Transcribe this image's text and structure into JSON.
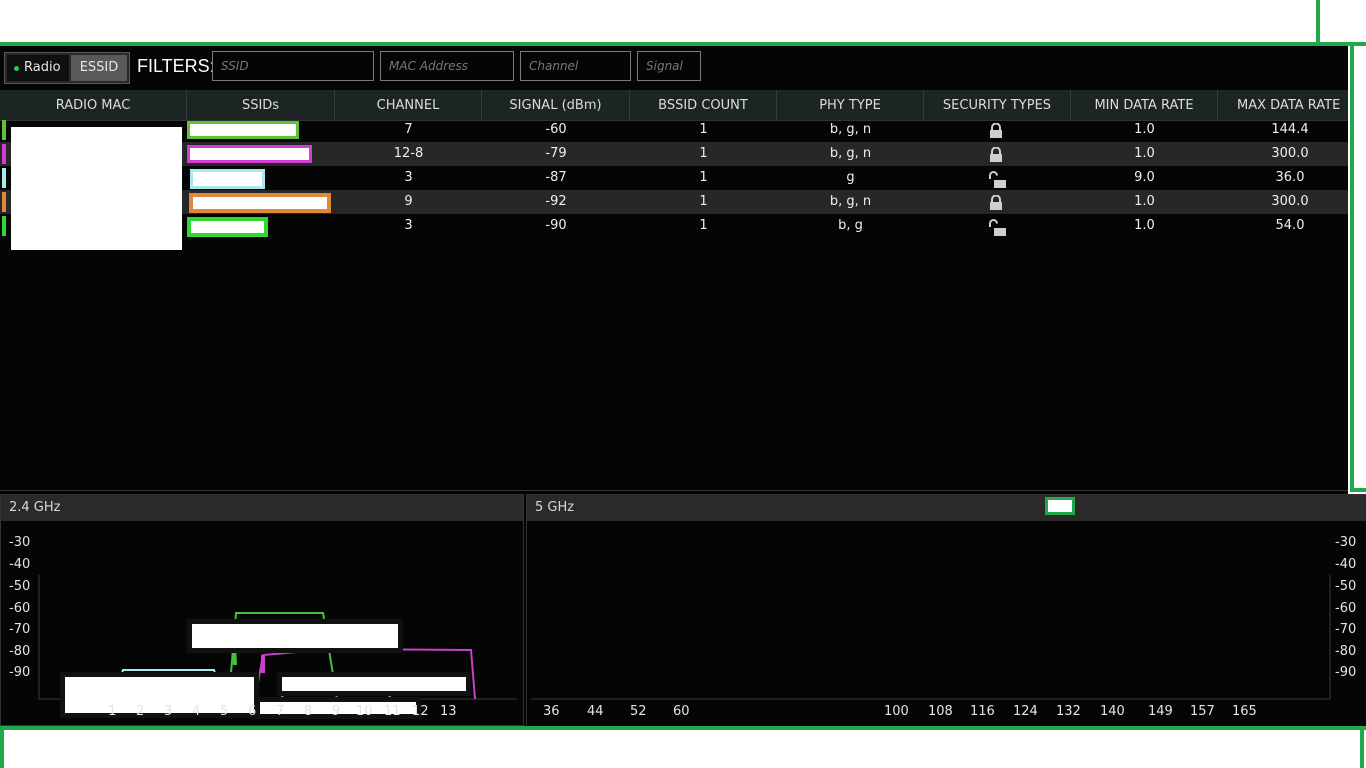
{
  "toolbar": {
    "mode_radio": "Radio",
    "mode_essid": "ESSID",
    "active_mode": "Radio",
    "filters_label": "FILTERS:",
    "ssid_placeholder": "SSID",
    "mac_placeholder": "MAC Address",
    "channel_placeholder": "Channel",
    "signal_placeholder": "Signal"
  },
  "table": {
    "headers": [
      "RADIO MAC",
      "SSIDs",
      "CHANNEL",
      "SIGNAL (dBm)",
      "BSSID COUNT",
      "PHY TYPE",
      "SECURITY TYPES",
      "MIN DATA RATE",
      "MAX DATA RATE"
    ],
    "rows": [
      {
        "color": "#5ec232",
        "channel": "7",
        "signal": "-60",
        "bssid_count": "1",
        "phy": "b, g, n",
        "secured": true,
        "min_rate": "1.0",
        "max_rate": "144.4"
      },
      {
        "color": "#d63bd6",
        "channel": "12-8",
        "signal": "-79",
        "bssid_count": "1",
        "phy": "b, g, n",
        "secured": true,
        "min_rate": "1.0",
        "max_rate": "300.0"
      },
      {
        "color": "#a8e8f0",
        "channel": "3",
        "signal": "-87",
        "bssid_count": "1",
        "phy": "g",
        "secured": false,
        "min_rate": "9.0",
        "max_rate": "36.0"
      },
      {
        "color": "#e0883a",
        "channel": "9",
        "signal": "-92",
        "bssid_count": "1",
        "phy": "b, g, n",
        "secured": true,
        "min_rate": "1.0",
        "max_rate": "300.0"
      },
      {
        "color": "#2ed82e",
        "channel": "3",
        "signal": "-90",
        "bssid_count": "1",
        "phy": "b, g",
        "secured": false,
        "min_rate": "1.0",
        "max_rate": "54.0"
      }
    ]
  },
  "panel_24": {
    "title": "2.4 GHz",
    "y_ticks": [
      "-30",
      "-40",
      "-50",
      "-60",
      "-70",
      "-80",
      "-90"
    ],
    "x_ticks": [
      "1",
      "2",
      "3",
      "4",
      "5",
      "6",
      "7",
      "8",
      "9",
      "10",
      "11",
      "12",
      "13"
    ]
  },
  "panel_5": {
    "title": "5 GHz",
    "y_ticks": [
      "-30",
      "-40",
      "-50",
      "-60",
      "-70",
      "-80",
      "-90"
    ],
    "x_ticks": [
      "36",
      "44",
      "52",
      "60",
      "100",
      "108",
      "116",
      "124",
      "132",
      "140",
      "149",
      "157",
      "165"
    ]
  }
}
